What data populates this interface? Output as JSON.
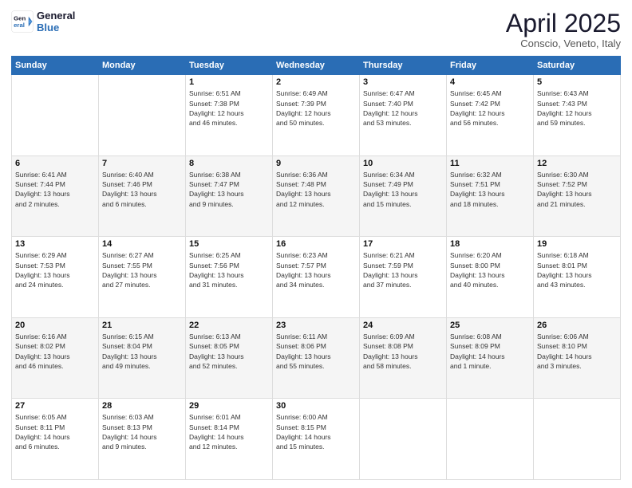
{
  "logo": {
    "line1": "General",
    "line2": "Blue"
  },
  "title": "April 2025",
  "subtitle": "Conscio, Veneto, Italy",
  "days_header": [
    "Sunday",
    "Monday",
    "Tuesday",
    "Wednesday",
    "Thursday",
    "Friday",
    "Saturday"
  ],
  "weeks": [
    [
      {
        "day": "",
        "info": ""
      },
      {
        "day": "",
        "info": ""
      },
      {
        "day": "1",
        "info": "Sunrise: 6:51 AM\nSunset: 7:38 PM\nDaylight: 12 hours\nand 46 minutes."
      },
      {
        "day": "2",
        "info": "Sunrise: 6:49 AM\nSunset: 7:39 PM\nDaylight: 12 hours\nand 50 minutes."
      },
      {
        "day": "3",
        "info": "Sunrise: 6:47 AM\nSunset: 7:40 PM\nDaylight: 12 hours\nand 53 minutes."
      },
      {
        "day": "4",
        "info": "Sunrise: 6:45 AM\nSunset: 7:42 PM\nDaylight: 12 hours\nand 56 minutes."
      },
      {
        "day": "5",
        "info": "Sunrise: 6:43 AM\nSunset: 7:43 PM\nDaylight: 12 hours\nand 59 minutes."
      }
    ],
    [
      {
        "day": "6",
        "info": "Sunrise: 6:41 AM\nSunset: 7:44 PM\nDaylight: 13 hours\nand 2 minutes."
      },
      {
        "day": "7",
        "info": "Sunrise: 6:40 AM\nSunset: 7:46 PM\nDaylight: 13 hours\nand 6 minutes."
      },
      {
        "day": "8",
        "info": "Sunrise: 6:38 AM\nSunset: 7:47 PM\nDaylight: 13 hours\nand 9 minutes."
      },
      {
        "day": "9",
        "info": "Sunrise: 6:36 AM\nSunset: 7:48 PM\nDaylight: 13 hours\nand 12 minutes."
      },
      {
        "day": "10",
        "info": "Sunrise: 6:34 AM\nSunset: 7:49 PM\nDaylight: 13 hours\nand 15 minutes."
      },
      {
        "day": "11",
        "info": "Sunrise: 6:32 AM\nSunset: 7:51 PM\nDaylight: 13 hours\nand 18 minutes."
      },
      {
        "day": "12",
        "info": "Sunrise: 6:30 AM\nSunset: 7:52 PM\nDaylight: 13 hours\nand 21 minutes."
      }
    ],
    [
      {
        "day": "13",
        "info": "Sunrise: 6:29 AM\nSunset: 7:53 PM\nDaylight: 13 hours\nand 24 minutes."
      },
      {
        "day": "14",
        "info": "Sunrise: 6:27 AM\nSunset: 7:55 PM\nDaylight: 13 hours\nand 27 minutes."
      },
      {
        "day": "15",
        "info": "Sunrise: 6:25 AM\nSunset: 7:56 PM\nDaylight: 13 hours\nand 31 minutes."
      },
      {
        "day": "16",
        "info": "Sunrise: 6:23 AM\nSunset: 7:57 PM\nDaylight: 13 hours\nand 34 minutes."
      },
      {
        "day": "17",
        "info": "Sunrise: 6:21 AM\nSunset: 7:59 PM\nDaylight: 13 hours\nand 37 minutes."
      },
      {
        "day": "18",
        "info": "Sunrise: 6:20 AM\nSunset: 8:00 PM\nDaylight: 13 hours\nand 40 minutes."
      },
      {
        "day": "19",
        "info": "Sunrise: 6:18 AM\nSunset: 8:01 PM\nDaylight: 13 hours\nand 43 minutes."
      }
    ],
    [
      {
        "day": "20",
        "info": "Sunrise: 6:16 AM\nSunset: 8:02 PM\nDaylight: 13 hours\nand 46 minutes."
      },
      {
        "day": "21",
        "info": "Sunrise: 6:15 AM\nSunset: 8:04 PM\nDaylight: 13 hours\nand 49 minutes."
      },
      {
        "day": "22",
        "info": "Sunrise: 6:13 AM\nSunset: 8:05 PM\nDaylight: 13 hours\nand 52 minutes."
      },
      {
        "day": "23",
        "info": "Sunrise: 6:11 AM\nSunset: 8:06 PM\nDaylight: 13 hours\nand 55 minutes."
      },
      {
        "day": "24",
        "info": "Sunrise: 6:09 AM\nSunset: 8:08 PM\nDaylight: 13 hours\nand 58 minutes."
      },
      {
        "day": "25",
        "info": "Sunrise: 6:08 AM\nSunset: 8:09 PM\nDaylight: 14 hours\nand 1 minute."
      },
      {
        "day": "26",
        "info": "Sunrise: 6:06 AM\nSunset: 8:10 PM\nDaylight: 14 hours\nand 3 minutes."
      }
    ],
    [
      {
        "day": "27",
        "info": "Sunrise: 6:05 AM\nSunset: 8:11 PM\nDaylight: 14 hours\nand 6 minutes."
      },
      {
        "day": "28",
        "info": "Sunrise: 6:03 AM\nSunset: 8:13 PM\nDaylight: 14 hours\nand 9 minutes."
      },
      {
        "day": "29",
        "info": "Sunrise: 6:01 AM\nSunset: 8:14 PM\nDaylight: 14 hours\nand 12 minutes."
      },
      {
        "day": "30",
        "info": "Sunrise: 6:00 AM\nSunset: 8:15 PM\nDaylight: 14 hours\nand 15 minutes."
      },
      {
        "day": "",
        "info": ""
      },
      {
        "day": "",
        "info": ""
      },
      {
        "day": "",
        "info": ""
      }
    ]
  ]
}
